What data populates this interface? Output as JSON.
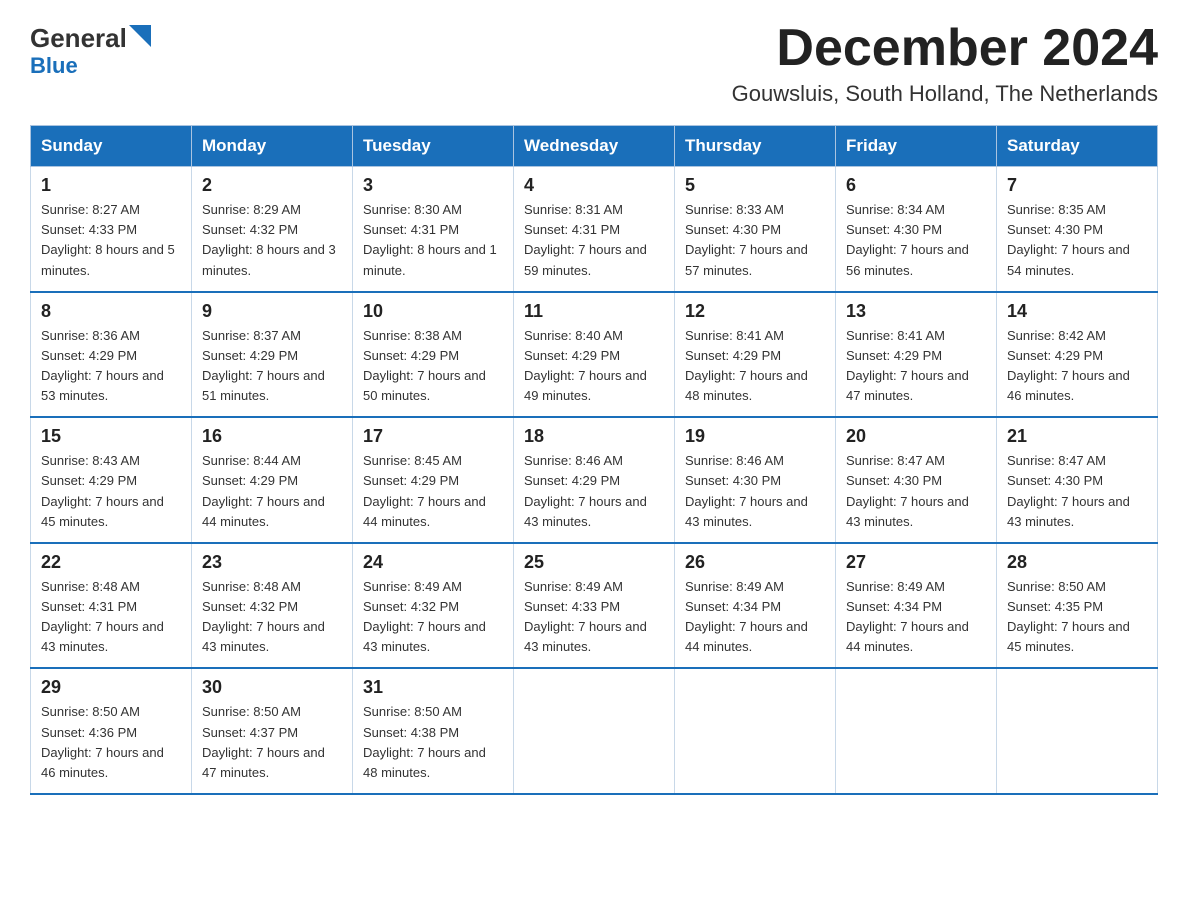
{
  "header": {
    "logo_general": "General",
    "logo_blue": "Blue",
    "month_title": "December 2024",
    "subtitle": "Gouwsluis, South Holland, The Netherlands"
  },
  "weekdays": [
    "Sunday",
    "Monday",
    "Tuesday",
    "Wednesday",
    "Thursday",
    "Friday",
    "Saturday"
  ],
  "weeks": [
    [
      {
        "day": "1",
        "sunrise": "8:27 AM",
        "sunset": "4:33 PM",
        "daylight": "8 hours and 5 minutes."
      },
      {
        "day": "2",
        "sunrise": "8:29 AM",
        "sunset": "4:32 PM",
        "daylight": "8 hours and 3 minutes."
      },
      {
        "day": "3",
        "sunrise": "8:30 AM",
        "sunset": "4:31 PM",
        "daylight": "8 hours and 1 minute."
      },
      {
        "day": "4",
        "sunrise": "8:31 AM",
        "sunset": "4:31 PM",
        "daylight": "7 hours and 59 minutes."
      },
      {
        "day": "5",
        "sunrise": "8:33 AM",
        "sunset": "4:30 PM",
        "daylight": "7 hours and 57 minutes."
      },
      {
        "day": "6",
        "sunrise": "8:34 AM",
        "sunset": "4:30 PM",
        "daylight": "7 hours and 56 minutes."
      },
      {
        "day": "7",
        "sunrise": "8:35 AM",
        "sunset": "4:30 PM",
        "daylight": "7 hours and 54 minutes."
      }
    ],
    [
      {
        "day": "8",
        "sunrise": "8:36 AM",
        "sunset": "4:29 PM",
        "daylight": "7 hours and 53 minutes."
      },
      {
        "day": "9",
        "sunrise": "8:37 AM",
        "sunset": "4:29 PM",
        "daylight": "7 hours and 51 minutes."
      },
      {
        "day": "10",
        "sunrise": "8:38 AM",
        "sunset": "4:29 PM",
        "daylight": "7 hours and 50 minutes."
      },
      {
        "day": "11",
        "sunrise": "8:40 AM",
        "sunset": "4:29 PM",
        "daylight": "7 hours and 49 minutes."
      },
      {
        "day": "12",
        "sunrise": "8:41 AM",
        "sunset": "4:29 PM",
        "daylight": "7 hours and 48 minutes."
      },
      {
        "day": "13",
        "sunrise": "8:41 AM",
        "sunset": "4:29 PM",
        "daylight": "7 hours and 47 minutes."
      },
      {
        "day": "14",
        "sunrise": "8:42 AM",
        "sunset": "4:29 PM",
        "daylight": "7 hours and 46 minutes."
      }
    ],
    [
      {
        "day": "15",
        "sunrise": "8:43 AM",
        "sunset": "4:29 PM",
        "daylight": "7 hours and 45 minutes."
      },
      {
        "day": "16",
        "sunrise": "8:44 AM",
        "sunset": "4:29 PM",
        "daylight": "7 hours and 44 minutes."
      },
      {
        "day": "17",
        "sunrise": "8:45 AM",
        "sunset": "4:29 PM",
        "daylight": "7 hours and 44 minutes."
      },
      {
        "day": "18",
        "sunrise": "8:46 AM",
        "sunset": "4:29 PM",
        "daylight": "7 hours and 43 minutes."
      },
      {
        "day": "19",
        "sunrise": "8:46 AM",
        "sunset": "4:30 PM",
        "daylight": "7 hours and 43 minutes."
      },
      {
        "day": "20",
        "sunrise": "8:47 AM",
        "sunset": "4:30 PM",
        "daylight": "7 hours and 43 minutes."
      },
      {
        "day": "21",
        "sunrise": "8:47 AM",
        "sunset": "4:30 PM",
        "daylight": "7 hours and 43 minutes."
      }
    ],
    [
      {
        "day": "22",
        "sunrise": "8:48 AM",
        "sunset": "4:31 PM",
        "daylight": "7 hours and 43 minutes."
      },
      {
        "day": "23",
        "sunrise": "8:48 AM",
        "sunset": "4:32 PM",
        "daylight": "7 hours and 43 minutes."
      },
      {
        "day": "24",
        "sunrise": "8:49 AM",
        "sunset": "4:32 PM",
        "daylight": "7 hours and 43 minutes."
      },
      {
        "day": "25",
        "sunrise": "8:49 AM",
        "sunset": "4:33 PM",
        "daylight": "7 hours and 43 minutes."
      },
      {
        "day": "26",
        "sunrise": "8:49 AM",
        "sunset": "4:34 PM",
        "daylight": "7 hours and 44 minutes."
      },
      {
        "day": "27",
        "sunrise": "8:49 AM",
        "sunset": "4:34 PM",
        "daylight": "7 hours and 44 minutes."
      },
      {
        "day": "28",
        "sunrise": "8:50 AM",
        "sunset": "4:35 PM",
        "daylight": "7 hours and 45 minutes."
      }
    ],
    [
      {
        "day": "29",
        "sunrise": "8:50 AM",
        "sunset": "4:36 PM",
        "daylight": "7 hours and 46 minutes."
      },
      {
        "day": "30",
        "sunrise": "8:50 AM",
        "sunset": "4:37 PM",
        "daylight": "7 hours and 47 minutes."
      },
      {
        "day": "31",
        "sunrise": "8:50 AM",
        "sunset": "4:38 PM",
        "daylight": "7 hours and 48 minutes."
      },
      null,
      null,
      null,
      null
    ]
  ]
}
